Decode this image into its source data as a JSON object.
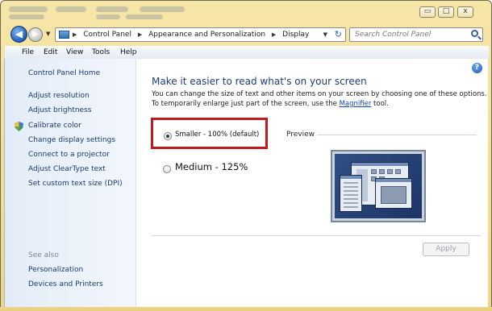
{
  "window": {
    "minimize": "▭",
    "maximize": "□",
    "close": "x"
  },
  "address_bar": {
    "crumbs": [
      "Control Panel",
      "Appearance and Personalization",
      "Display"
    ],
    "separator": "▶",
    "search_placeholder": "Search Control Panel"
  },
  "menu": [
    "File",
    "Edit",
    "View",
    "Tools",
    "Help"
  ],
  "sidebar": {
    "home": "Control Panel Home",
    "links": [
      "Adjust resolution",
      "Adjust brightness",
      "Calibrate color",
      "Change display settings",
      "Connect to a projector",
      "Adjust ClearType text",
      "Set custom text size (DPI)"
    ],
    "see_also_label": "See also",
    "see_also": [
      "Personalization",
      "Devices and Printers"
    ]
  },
  "main": {
    "heading": "Make it easier to read what's on your screen",
    "description_1": "You can change the size of text and other items on your screen by choosing one of these options.",
    "description_2_prefix": "To temporarily enlarge just part of the screen, use the ",
    "description_link": "Magnifier",
    "description_2_suffix": " tool.",
    "options": [
      {
        "label": "Smaller - 100% (default)",
        "selected": true
      },
      {
        "label": "Medium - 125%",
        "selected": false
      }
    ],
    "preview_label": "Preview",
    "apply_label": "Apply",
    "help": "?"
  },
  "colors": {
    "highlight_border": "#c3181d",
    "link": "#1a3a70",
    "heading": "#1d3d75",
    "frame": "#f3dd92"
  }
}
